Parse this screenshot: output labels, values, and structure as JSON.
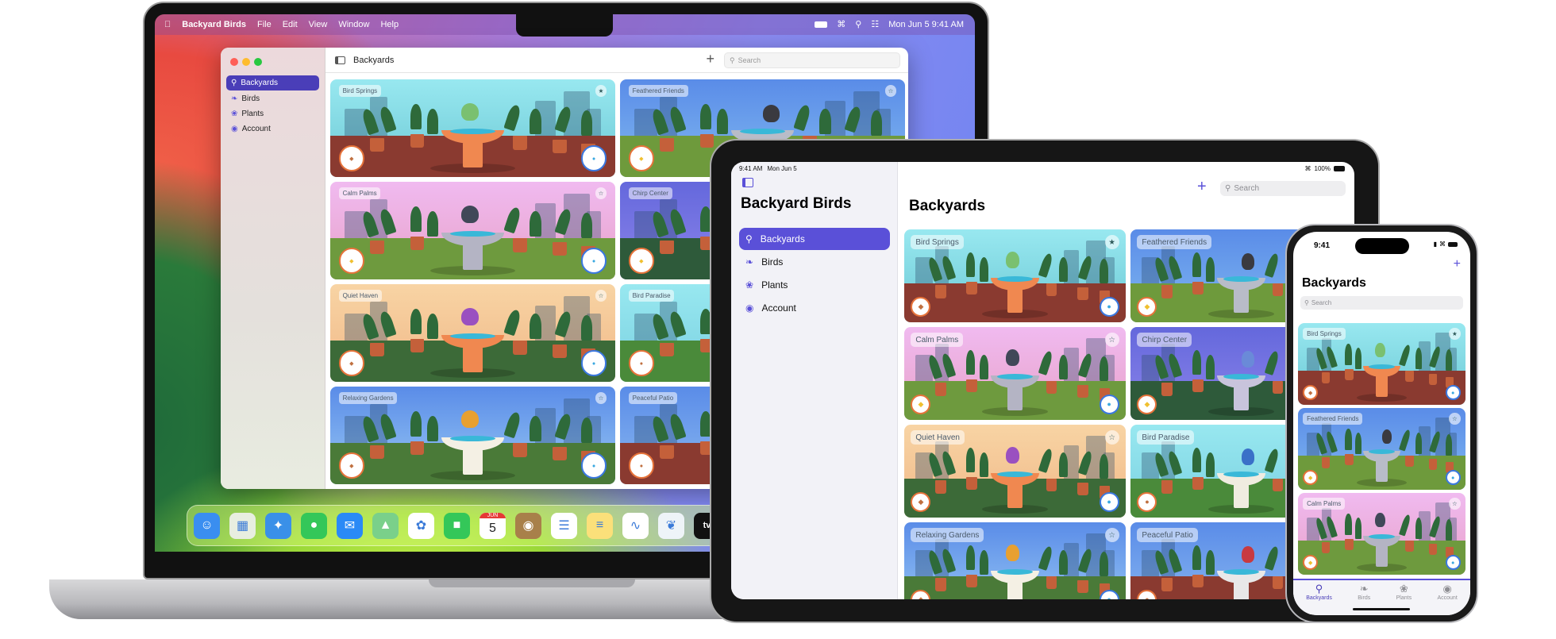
{
  "colors": {
    "accent": "#5a50d8",
    "mac_selected": "#4a3eb8"
  },
  "mac": {
    "menubar": {
      "app": "Backyard Birds",
      "menus": [
        "File",
        "Edit",
        "View",
        "Window",
        "Help"
      ],
      "datetime": "Mon Jun 5  9:41 AM",
      "status_icons": [
        "battery-icon",
        "wifi-icon",
        "search-icon",
        "control-center-icon"
      ]
    },
    "window": {
      "title": "Backyards",
      "search_placeholder": "Search",
      "add_label": "+",
      "sidebar": [
        {
          "label": "Backyards",
          "icon": "birdbath-icon",
          "selected": true
        },
        {
          "label": "Birds",
          "icon": "bird-icon"
        },
        {
          "label": "Plants",
          "icon": "leaf-icon"
        },
        {
          "label": "Account",
          "icon": "person-icon"
        }
      ]
    },
    "dock": [
      {
        "name": "Finder",
        "icon": "finder-icon",
        "color": "#3a8ef0"
      },
      {
        "name": "Launchpad",
        "icon": "launchpad-icon",
        "color": "#e8eee0"
      },
      {
        "name": "Safari",
        "icon": "safari-icon",
        "color": "#3a90e8"
      },
      {
        "name": "Messages",
        "icon": "messages-icon",
        "color": "#34c759"
      },
      {
        "name": "Mail",
        "icon": "mail-icon",
        "color": "#2a8af6"
      },
      {
        "name": "Maps",
        "icon": "maps-icon",
        "color": "#7ad08a"
      },
      {
        "name": "Photos",
        "icon": "photos-icon",
        "color": "#ffffff"
      },
      {
        "name": "FaceTime",
        "icon": "facetime-icon",
        "color": "#34c759"
      },
      {
        "name": "Calendar",
        "icon": "calendar-icon",
        "color": "#ffffff",
        "month": "JUN",
        "day": "5"
      },
      {
        "name": "Contacts",
        "icon": "contacts-icon",
        "color": "#a8804a"
      },
      {
        "name": "Reminders",
        "icon": "reminders-icon",
        "color": "#ffffff"
      },
      {
        "name": "Notes",
        "icon": "notes-icon",
        "color": "#fbe07a"
      },
      {
        "name": "Freeform",
        "icon": "freeform-icon",
        "color": "#ffffff"
      },
      {
        "name": "Backyard Birds",
        "icon": "hummingbird-icon",
        "color": "#eef4f8"
      },
      {
        "name": "TV",
        "icon": "tv-icon",
        "color": "#111111",
        "label": "tv"
      }
    ]
  },
  "ipad": {
    "status": {
      "time": "9:41 AM",
      "date": "Mon Jun 5",
      "battery": "100%"
    },
    "sidebar_title": "Backyard Birds",
    "sidebar": [
      {
        "label": "Backyards",
        "icon": "birdbath-icon",
        "selected": true
      },
      {
        "label": "Birds",
        "icon": "bird-icon"
      },
      {
        "label": "Plants",
        "icon": "leaf-icon"
      },
      {
        "label": "Account",
        "icon": "person-icon"
      }
    ],
    "title": "Backyards",
    "search_placeholder": "Search",
    "add_label": "+"
  },
  "iphone": {
    "status": {
      "time": "9:41"
    },
    "title": "Backyards",
    "search_placeholder": "Search",
    "add_label": "+",
    "tabs": [
      {
        "label": "Backyards",
        "icon": "birdbath-icon",
        "selected": true
      },
      {
        "label": "Birds",
        "icon": "bird-icon"
      },
      {
        "label": "Plants",
        "icon": "leaf-icon"
      },
      {
        "label": "Account",
        "icon": "person-icon"
      }
    ]
  },
  "backyards": [
    {
      "name": "Bird Springs",
      "starred": true,
      "sky": [
        "#98e8f0",
        "#6cc8d4"
      ],
      "ground": "#8a3a30",
      "bath": "#f08850",
      "bird": "#7ac070",
      "food": "seeds"
    },
    {
      "name": "Feathered Friends",
      "starred": false,
      "sky": [
        "#5a8ce8",
        "#80b8f0"
      ],
      "ground": "#6e9a3c",
      "bath": "#b8bcc8",
      "bird": "#3a3a40",
      "food": "suet"
    },
    {
      "name": "Calm Palms",
      "starred": false,
      "sky": [
        "#f0baf0",
        "#e8a2c8"
      ],
      "ground": "#6e9a3e",
      "bath": "#b4b4c4",
      "bird": "#404858",
      "food": "suet"
    },
    {
      "name": "Chirp Center",
      "starred": false,
      "sky": [
        "#6468dc",
        "#8c84ea"
      ],
      "ground": "#2e5a3a",
      "bath": "#c8c4dc",
      "bird": "#6a8ad8",
      "food": "suet"
    },
    {
      "name": "Quiet Haven",
      "starred": false,
      "sky": [
        "#f8d4a4",
        "#f0b888"
      ],
      "ground": "#3c6a38",
      "bath": "#f08850",
      "bird": "#9a50c0",
      "food": "seeds"
    },
    {
      "name": "Bird Paradise",
      "starred": false,
      "sky": [
        "#98e8f0",
        "#7ad0e0"
      ],
      "ground": "#4a8a3a",
      "bath": "#f0ece0",
      "bird": "#3a70c8",
      "food": "berries"
    },
    {
      "name": "Relaxing Gardens",
      "starred": false,
      "sky": [
        "#5a8ce8",
        "#98c8f4"
      ],
      "ground": "#4a7a38",
      "bath": "#f4f0e4",
      "bird": "#e8a030",
      "food": "seeds"
    },
    {
      "name": "Peaceful Patio",
      "starred": false,
      "sky": [
        "#5a8ce8",
        "#8ab8f0"
      ],
      "ground": "#8a3a30",
      "bath": "#e8e8e8",
      "bird": "#c83a40",
      "food": "berries"
    }
  ]
}
